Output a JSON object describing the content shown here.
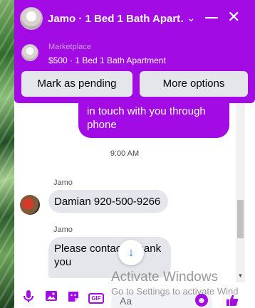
{
  "header": {
    "title": "Jamo · 1 Bed 1 Bath Apart…",
    "chevron_icon": "chevron-down-icon",
    "minimize_icon": "minimize-icon",
    "close_icon": "close-icon"
  },
  "listing": {
    "source": "Marketplace",
    "name": "$500 · 1 Bed 1 Bath Apartment"
  },
  "buttons": {
    "mark_pending": "Mark as pending",
    "more_options": "More options"
  },
  "messages": {
    "outgoing_text": "in touch with you through phone",
    "timestamp": "9:00 AM",
    "groups": [
      {
        "sender": "Jamo",
        "text": "Damian 920-500-9266"
      },
      {
        "sender": "Jamo",
        "text": "Please contac… thank you"
      }
    ]
  },
  "composer": {
    "placeholder": "Aa",
    "gif_label": "GIF"
  },
  "watermark": {
    "title": "Activate Windows",
    "subtitle": "Go to Settings to activate Wind"
  },
  "colors": {
    "accent": "#a20be3",
    "bubble_gray": "#e4e6eb",
    "scroll_down_arrow": "#1877f2"
  }
}
